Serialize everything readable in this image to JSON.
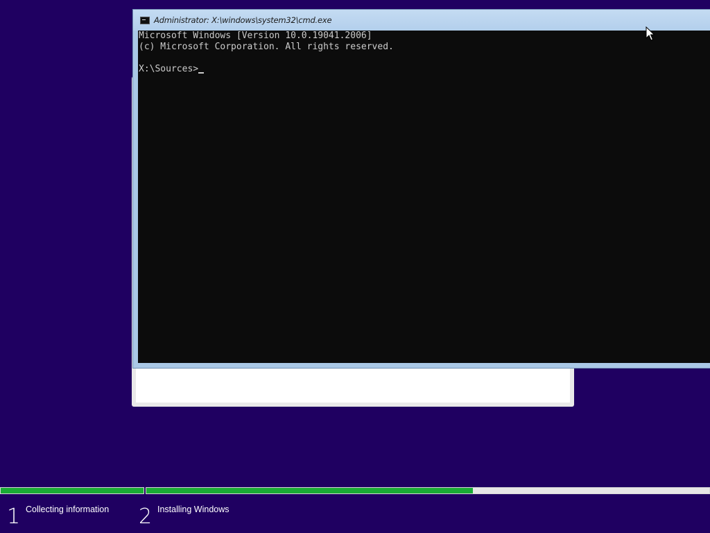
{
  "cmd_window": {
    "title": "Administrator: X:\\windows\\system32\\cmd.exe",
    "icon": "cmd-icon",
    "lines": [
      "Microsoft Windows [Version 10.0.19041.2006]",
      "(c) Microsoft Corporation. All rights reserved.",
      ""
    ],
    "prompt": "X:\\Sources>"
  },
  "setup": {
    "steps": [
      {
        "number": "1",
        "label": "Collecting information",
        "progress": 1.0
      },
      {
        "number": "2",
        "label": "Installing Windows",
        "progress": 0.58
      }
    ]
  },
  "colors": {
    "desktop_background": "#1f0061",
    "console_background": "#0c0c0c",
    "console_text": "#cccccc",
    "progress_green": "#1aab35",
    "window_frame": "#aac8e6"
  }
}
